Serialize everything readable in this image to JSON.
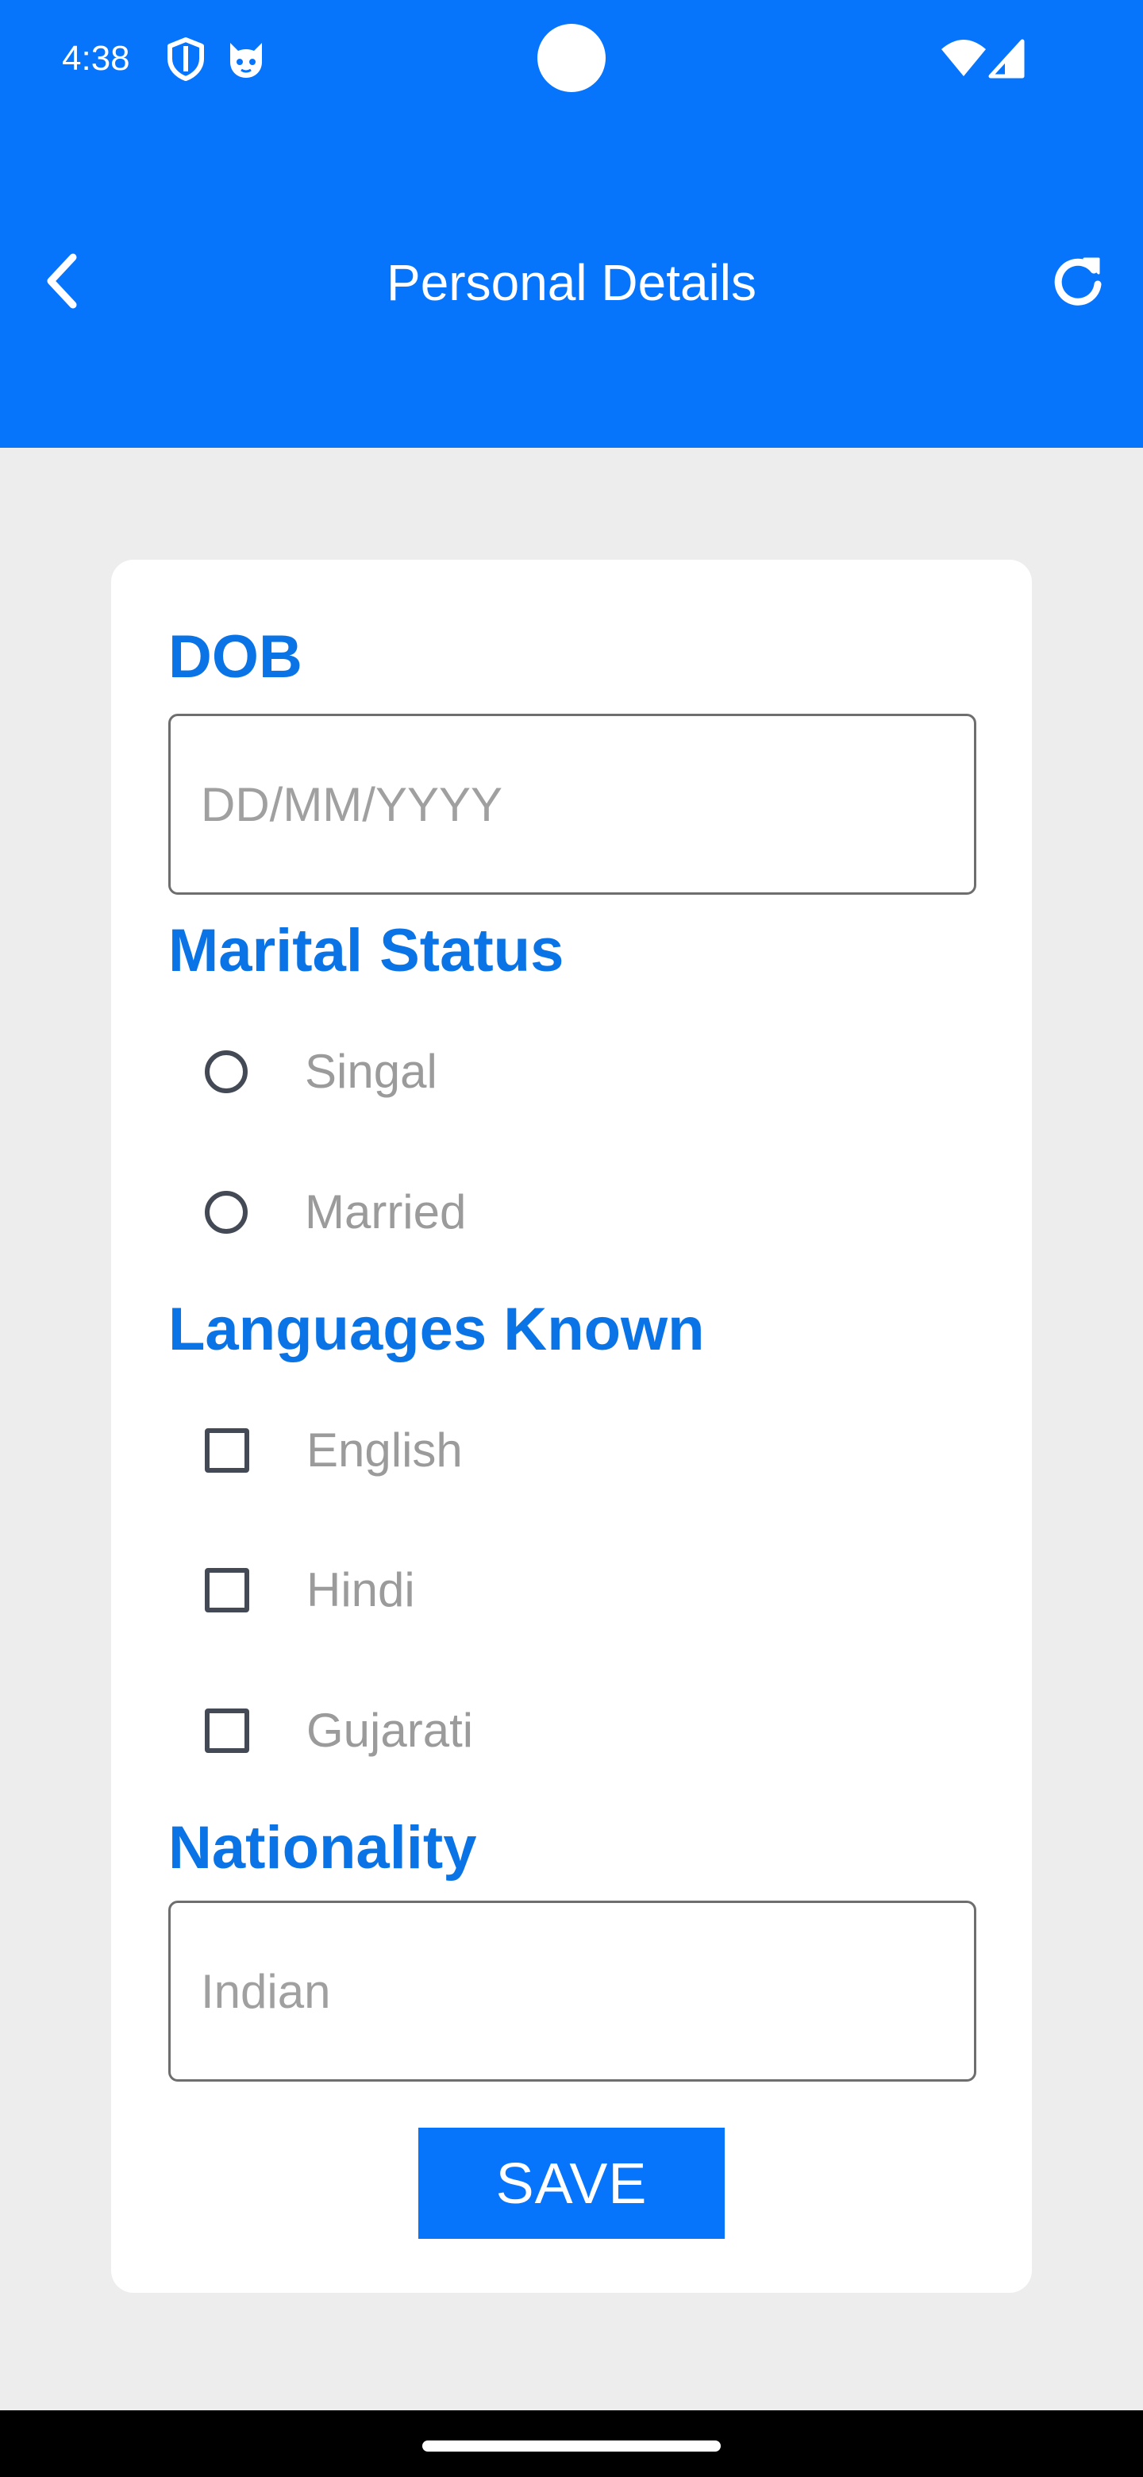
{
  "status_bar": {
    "time": "4:38",
    "icons": [
      "shield-icon",
      "cat-face-icon",
      "wifi-icon",
      "cellular-signal-icon"
    ]
  },
  "toolbar": {
    "title": "Personal Details",
    "back_icon": "chevron-left-icon",
    "refresh_icon": "refresh-icon"
  },
  "form": {
    "dob": {
      "label": "DOB",
      "placeholder": "DD/MM/YYYY",
      "value": ""
    },
    "marital_status": {
      "label": "Marital Status",
      "options": [
        {
          "label": "Singal",
          "selected": false
        },
        {
          "label": "Married",
          "selected": false
        }
      ]
    },
    "languages": {
      "label": "Languages Known",
      "options": [
        {
          "label": "English",
          "checked": false
        },
        {
          "label": "Hindi",
          "checked": false
        },
        {
          "label": "Gujarati",
          "checked": false
        }
      ]
    },
    "nationality": {
      "label": "Nationality",
      "placeholder": "Indian",
      "value": ""
    },
    "save_label": "SAVE"
  },
  "colors": {
    "primary": "#0775fb",
    "label": "#0a74e6",
    "background": "#ededed",
    "option_text": "#9b9b9b"
  }
}
